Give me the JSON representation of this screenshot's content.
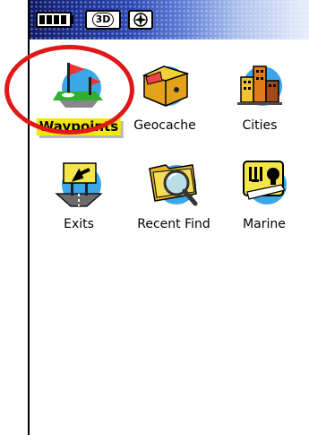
{
  "statusbar": {
    "battery_icon": "battery-full-icon",
    "gps_mode": "3D",
    "compass_icon": "compass-icon"
  },
  "menu": {
    "items": [
      {
        "label": "Waypoints",
        "icon": "waypoint-flags-icon",
        "selected": true
      },
      {
        "label": "Geocache",
        "icon": "treasure-chest-icon",
        "selected": false
      },
      {
        "label": "Cities",
        "icon": "buildings-icon",
        "selected": false
      },
      {
        "label": "Exits",
        "icon": "highway-exit-icon",
        "selected": false
      },
      {
        "label": "Recent Find",
        "icon": "folder-magnifier-icon",
        "selected": false
      },
      {
        "label": "Marine",
        "icon": "marine-services-icon",
        "selected": false
      }
    ]
  },
  "colors": {
    "selection_highlight": "#f6e60e",
    "annotation_ring": "#e01818"
  }
}
